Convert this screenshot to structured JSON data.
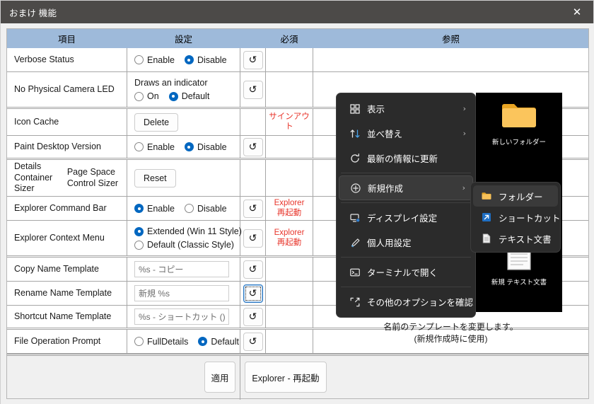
{
  "window": {
    "title": "おまけ 機能",
    "close_icon": "close-icon",
    "close_glyph": "✕"
  },
  "grid": {
    "headers": [
      "項目",
      "設定",
      "",
      "必須",
      "参照"
    ],
    "undo_glyph": "↺",
    "rows": [
      {
        "item": "Verbose Status",
        "type": "radio",
        "options": [
          {
            "label": "Enable",
            "selected": false
          },
          {
            "label": "Disable",
            "selected": true
          }
        ],
        "undo": true,
        "required": "",
        "group_end": false
      },
      {
        "item": "No Physical Camera LED",
        "type": "note-radio",
        "note": "Draws an indicator",
        "options": [
          {
            "label": "On",
            "selected": false
          },
          {
            "label": "Default",
            "selected": true
          }
        ],
        "undo": true,
        "required": "",
        "group_end": true
      },
      {
        "item": "Icon Cache",
        "type": "button",
        "button_label": "Delete",
        "undo": false,
        "required": "サインアウト",
        "group_end": false
      },
      {
        "item": "Paint Desktop Version",
        "type": "radio",
        "options": [
          {
            "label": "Enable",
            "selected": false
          },
          {
            "label": "Disable",
            "selected": true
          }
        ],
        "undo": true,
        "required": "",
        "group_end": true
      },
      {
        "item": "Details Container Sizer",
        "item2": "Page Space Control Sizer",
        "type": "button",
        "button_label": "Reset",
        "undo": false,
        "required": "",
        "group_end": false
      },
      {
        "item": "Explorer Command Bar",
        "type": "radio",
        "options": [
          {
            "label": "Enable",
            "selected": true
          },
          {
            "label": "Disable",
            "selected": false
          }
        ],
        "undo": true,
        "required": "Explorer\n再起動",
        "group_end": false
      },
      {
        "item": "Explorer Context Menu",
        "type": "radio-stack",
        "options": [
          {
            "label": "Extended (Win 11 Style)",
            "selected": true
          },
          {
            "label": "Default (Classic Style)",
            "selected": false
          }
        ],
        "undo": true,
        "required": "Explorer\n再起動",
        "group_end": true
      },
      {
        "item": "Copy Name Template",
        "type": "text",
        "value": "%s - コピー",
        "undo": true,
        "undo_focused": false,
        "required": "",
        "group_end": false
      },
      {
        "item": "Rename Name Template",
        "type": "text",
        "value": "新規 %s",
        "undo": true,
        "undo_focused": true,
        "required": "",
        "group_end": false
      },
      {
        "item": "Shortcut Name Template",
        "type": "text",
        "value": "%s - ショートカット ().lnk",
        "undo": true,
        "undo_focused": false,
        "required": "",
        "group_end": true
      },
      {
        "item": "File Operation Prompt",
        "type": "radio",
        "options": [
          {
            "label": "FullDetails",
            "selected": false
          },
          {
            "label": "Default",
            "selected": true
          }
        ],
        "undo": true,
        "required": "",
        "group_end": false
      }
    ]
  },
  "reference": {
    "context_menu": [
      {
        "icon": "view-grid-icon",
        "glyph": "▦",
        "label": "表示",
        "arrow": "›",
        "selected": false,
        "sep_after": false
      },
      {
        "icon": "sort-arrows-icon",
        "glyph": "⇅",
        "label": "並べ替え",
        "arrow": "›",
        "selected": false,
        "sep_after": false
      },
      {
        "icon": "refresh-icon",
        "glyph": "↻",
        "label": "最新の情報に更新",
        "arrow": "",
        "selected": false,
        "sep_after": true
      },
      {
        "icon": "plus-circle-icon",
        "glyph": "⊕",
        "label": "新規作成",
        "arrow": "›",
        "selected": true,
        "sep_after": true
      },
      {
        "icon": "display-settings-icon",
        "glyph": "▭",
        "label": "ディスプレイ設定",
        "arrow": "",
        "selected": false,
        "sep_after": false
      },
      {
        "icon": "personalize-brush-icon",
        "glyph": "∕",
        "label": "個人用設定",
        "arrow": "",
        "selected": false,
        "sep_after": true
      },
      {
        "icon": "terminal-icon",
        "glyph": "⌨",
        "label": "ターミナルで開く",
        "arrow": "",
        "selected": false,
        "sep_after": true
      },
      {
        "icon": "more-options-icon",
        "glyph": "⤢",
        "label": "その他のオプションを確認",
        "arrow": "",
        "selected": false,
        "sep_after": false
      }
    ],
    "submenu": [
      {
        "icon": "folder-icon",
        "label": "フォルダー",
        "selected": true
      },
      {
        "icon": "shortcut-arrow-icon",
        "label": "ショートカット",
        "selected": false
      },
      {
        "icon": "text-document-icon",
        "label": "テキスト文書",
        "selected": false
      }
    ],
    "desktop_icons": [
      {
        "icon": "folder-icon",
        "caption": "新しいフォルダー"
      },
      {
        "icon": "text-document-icon",
        "caption": "新規 テキスト文書"
      }
    ],
    "caption_line1": "名前のテンプレートを変更します。",
    "caption_line2": "(新規作成時に使用)"
  },
  "footer": {
    "apply_label": "適用",
    "restart_label": "Explorer - 再起動"
  },
  "colors": {
    "header_blue": "#9ebada",
    "accent_blue": "#0067c0",
    "required_red": "#e8352b",
    "titlebar": "#4c4a48",
    "menu_dark": "#2b2b2b"
  }
}
